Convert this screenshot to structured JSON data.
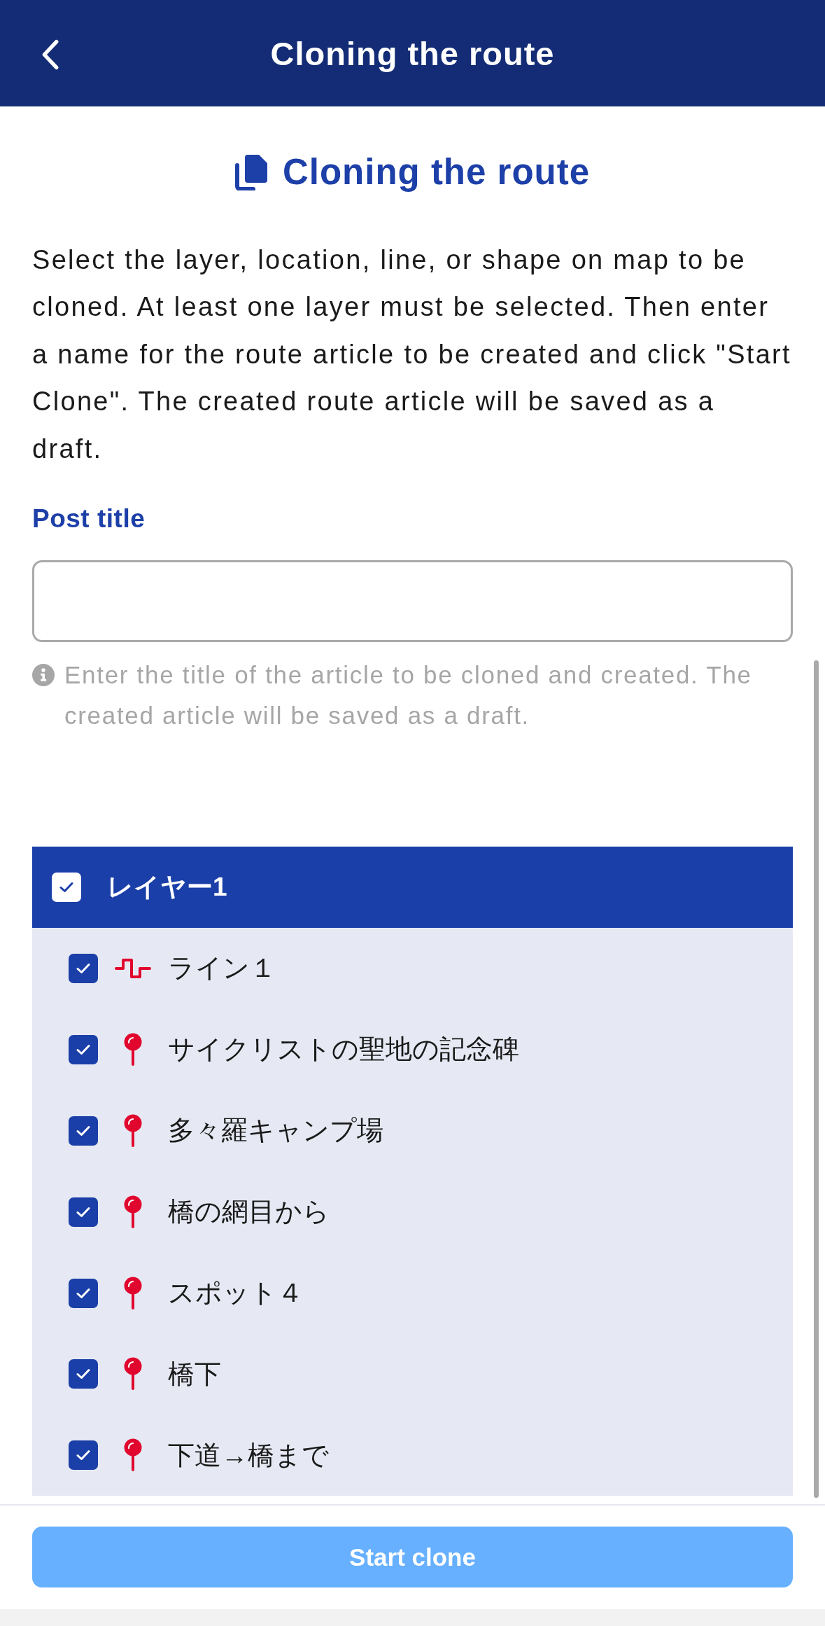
{
  "header": {
    "title": "Cloning the route"
  },
  "section": {
    "title": "Cloning the route",
    "description": "Select the layer, location, line, or shape on map to be cloned. At least one layer must be selected. Then enter a name for the route article to be created and click \"Start Clone\". The created route article will be saved as a draft."
  },
  "post_title": {
    "label": "Post title",
    "hint": "Enter the title of the article to be cloned and created. The created article will be saved as a draft."
  },
  "layers": [
    {
      "name": "レイヤー1",
      "checked": true,
      "items": [
        {
          "kind": "line",
          "name": "ライン１",
          "checked": true
        },
        {
          "kind": "location",
          "name": "サイクリストの聖地の記念碑",
          "checked": true
        },
        {
          "kind": "location",
          "name": "多々羅キャンプ場",
          "checked": true
        },
        {
          "kind": "location",
          "name": "橋の網目から",
          "checked": true
        },
        {
          "kind": "location",
          "name": "スポット４",
          "checked": true
        },
        {
          "kind": "location",
          "name": "橋下",
          "checked": true
        },
        {
          "kind": "location",
          "name": "下道→橋まで",
          "checked": true
        }
      ]
    }
  ],
  "footer": {
    "start_button": {
      "label": "Start clone",
      "disabled": true
    }
  }
}
